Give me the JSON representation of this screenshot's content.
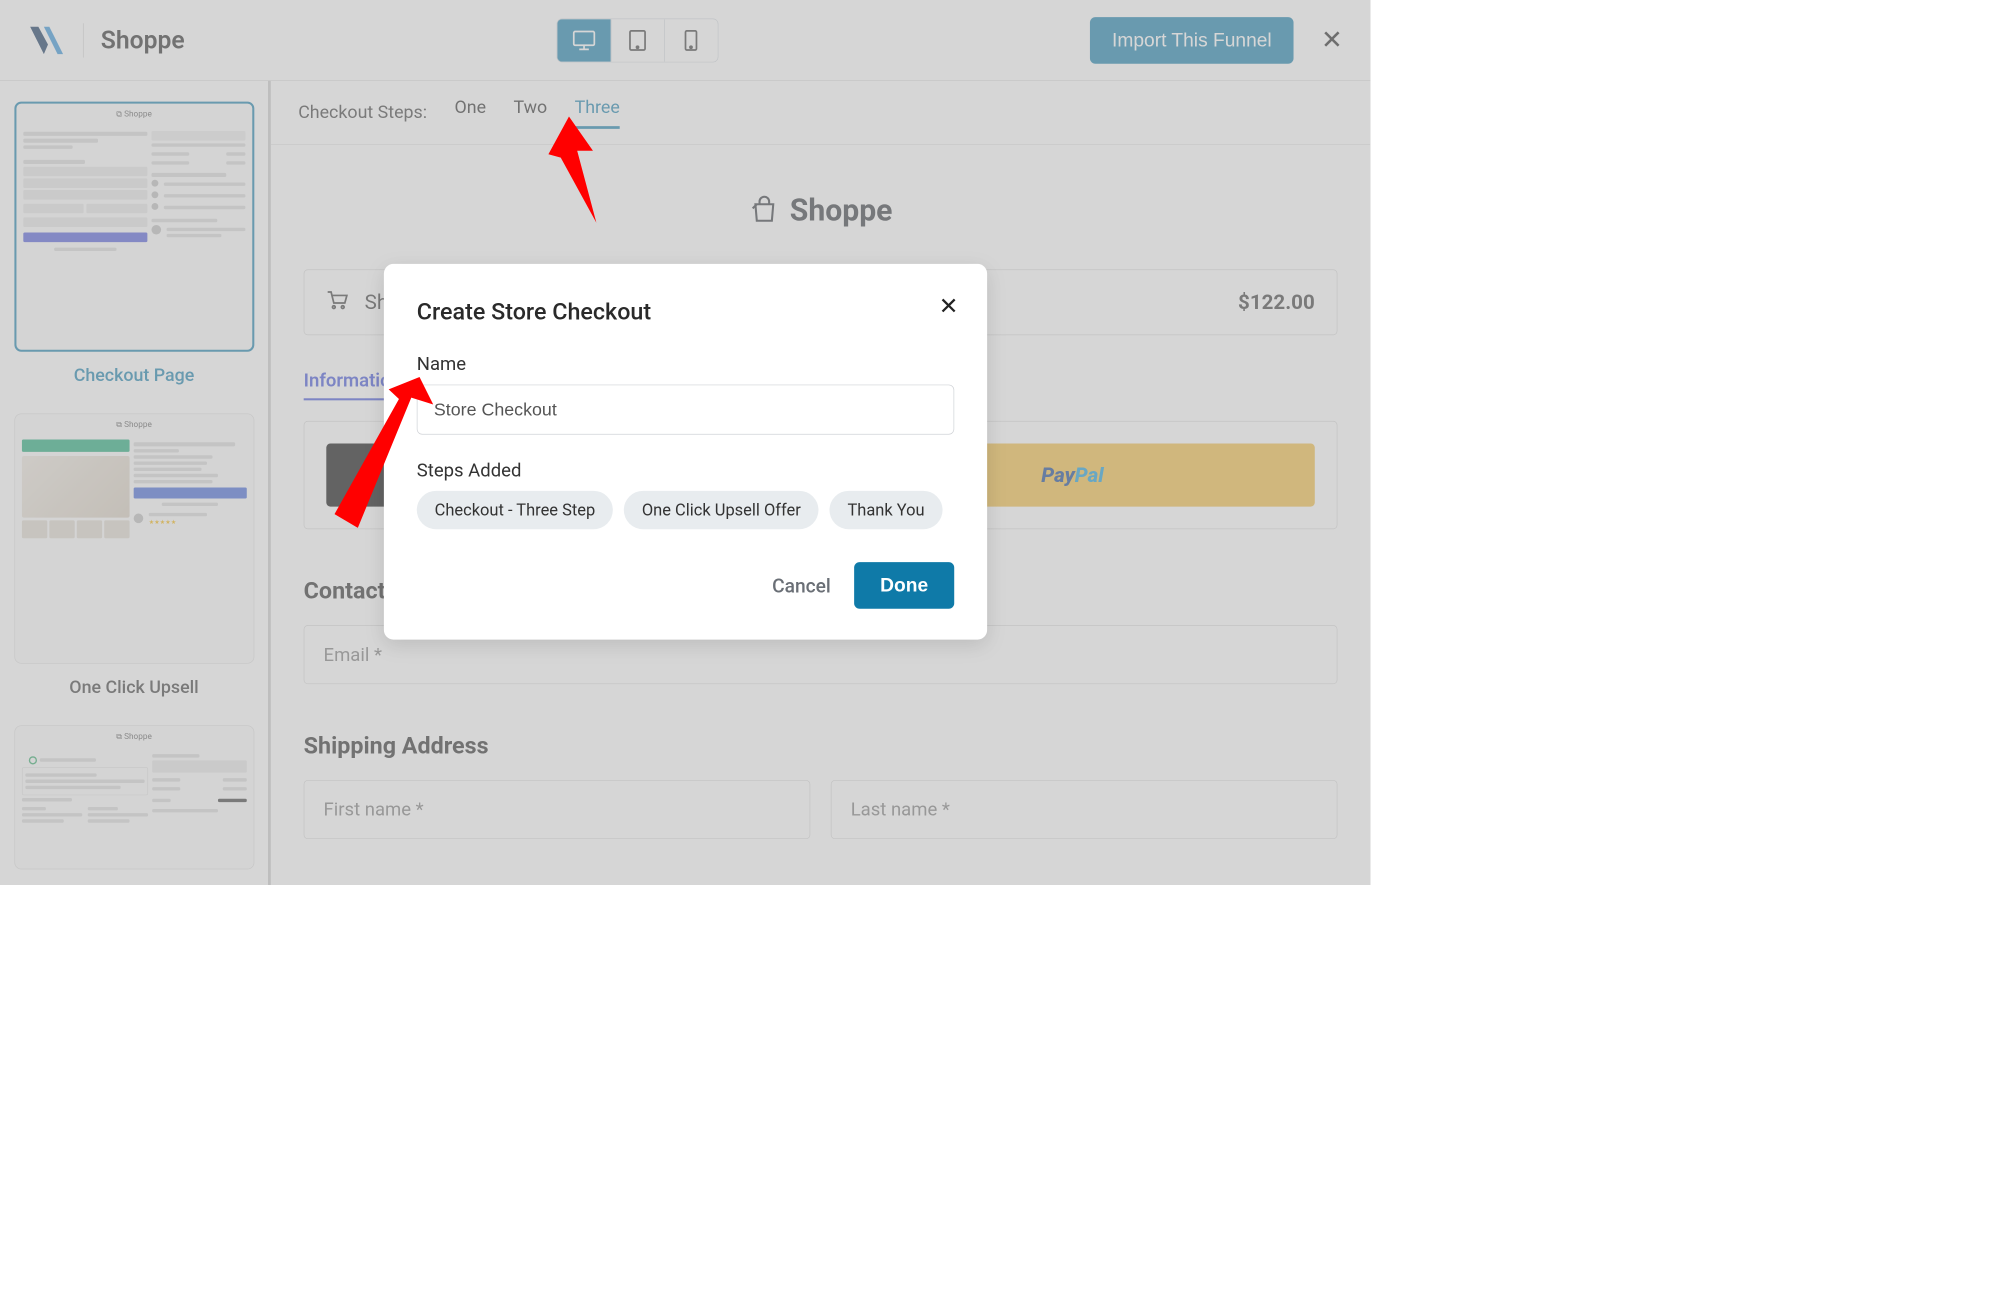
{
  "header": {
    "app_name": "Shoppe",
    "import_label": "Import This Funnel"
  },
  "steps": {
    "label": "Checkout Steps:",
    "tabs": [
      "One",
      "Two",
      "Three"
    ],
    "active_index": 2
  },
  "sidebar": {
    "thumbs": [
      {
        "label": "Checkout Page",
        "active": true
      },
      {
        "label": "One Click Upsell",
        "active": false
      },
      {
        "label": "",
        "active": false
      }
    ]
  },
  "canvas": {
    "brand_name": "Shoppe",
    "summary": {
      "show_label": "Show Order Summary",
      "total": "$122.00"
    },
    "info_tab": "Information",
    "paypal_text": "PayPal",
    "contact_title": "Contact Information",
    "email_placeholder": "Email *",
    "shipping_title": "Shipping Address",
    "first_name_placeholder": "First name *",
    "last_name_placeholder": "Last name *"
  },
  "modal": {
    "title": "Create Store Checkout",
    "name_label": "Name",
    "name_value": "Store Checkout",
    "steps_label": "Steps Added",
    "chips": [
      "Checkout - Three Step",
      "One Click Upsell Offer",
      "Thank You"
    ],
    "cancel": "Cancel",
    "done": "Done"
  }
}
